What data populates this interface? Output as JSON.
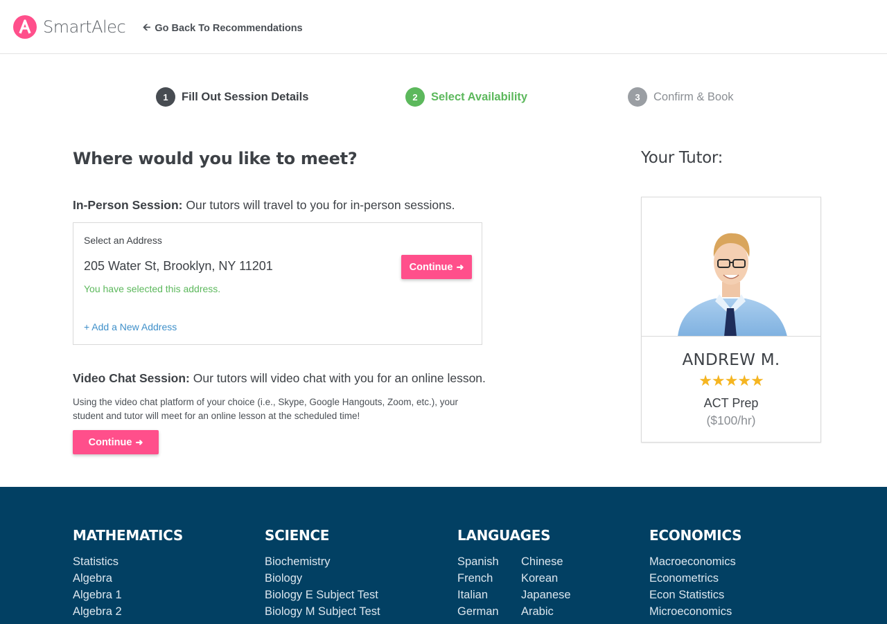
{
  "header": {
    "brand": "SmartAlec",
    "back_link": "Go Back To Recommendations"
  },
  "steps": [
    {
      "num": "1",
      "label": "Fill Out Session Details"
    },
    {
      "num": "2",
      "label": "Select Availability"
    },
    {
      "num": "3",
      "label": "Confirm & Book"
    }
  ],
  "main": {
    "title": "Where would you like to meet?",
    "in_person": {
      "heading": "In-Person Session:",
      "text": " Our tutors will travel to you for in-person sessions.",
      "select_label": "Select an Address",
      "address": "205 Water St, Brooklyn, NY 11201",
      "selected_note": "You have selected this address.",
      "add_address": "+ Add a New Address",
      "continue": "Continue"
    },
    "video": {
      "heading": "Video Chat Session:",
      "text": " Our tutors will video chat with you for an online lesson.",
      "desc": "Using the video chat platform of your choice (i.e., Skype, Google Hangouts, Zoom, etc.), your student and tutor will meet for an online lesson at the scheduled time!",
      "continue": "Continue"
    }
  },
  "tutor": {
    "title": "Your Tutor:",
    "name": "ANDREW M.",
    "stars": "★★★★★",
    "rating": 5,
    "subject": "ACT Prep",
    "rate": "($100/hr)"
  },
  "footer": {
    "columns": [
      {
        "heading": "MATHEMATICS",
        "links": [
          "Statistics",
          "Algebra",
          "Algebra 1",
          "Algebra 2"
        ]
      },
      {
        "heading": "SCIENCE",
        "links": [
          "Biochemistry",
          "Biology",
          "Biology E Subject Test",
          "Biology M Subject Test"
        ]
      },
      {
        "heading": "LANGUAGES",
        "links_a": [
          "Spanish",
          "French",
          "Italian",
          "German"
        ],
        "links_b": [
          "Chinese",
          "Korean",
          "Japanese",
          "Arabic"
        ]
      },
      {
        "heading": "ECONOMICS",
        "links": [
          "Macroeconomics",
          "Econometrics",
          "Econ Statistics",
          "Microeconomics"
        ]
      }
    ]
  },
  "colors": {
    "brand_pink": "#ff4f8b",
    "success_green": "#5cb85c",
    "link_blue": "#3e8fc9",
    "footer_bg": "#024063",
    "star_gold": "#f5b521"
  }
}
